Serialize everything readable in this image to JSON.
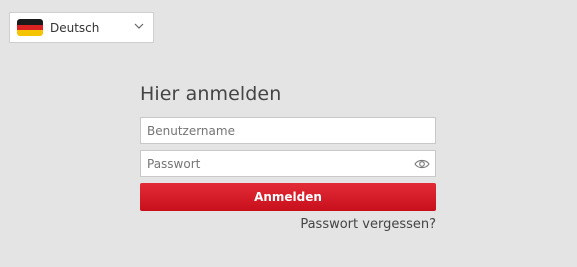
{
  "language_selector": {
    "selected_label": "Deutsch",
    "flag_icon": "germany-flag-icon",
    "flag_colors": [
      "#1a1a1a",
      "#dd2222",
      "#f5c400"
    ],
    "chevron_icon": "chevron-down-icon"
  },
  "login": {
    "title": "Hier anmelden",
    "username_placeholder": "Benutzername",
    "username_value": "",
    "password_placeholder": "Passwort",
    "password_value": "",
    "show_password_icon": "eye-icon",
    "submit_label": "Anmelden",
    "forgot_password_label": "Passwort vergessen?"
  },
  "colors": {
    "background": "#e4e4e4",
    "accent": "#d3151f"
  }
}
